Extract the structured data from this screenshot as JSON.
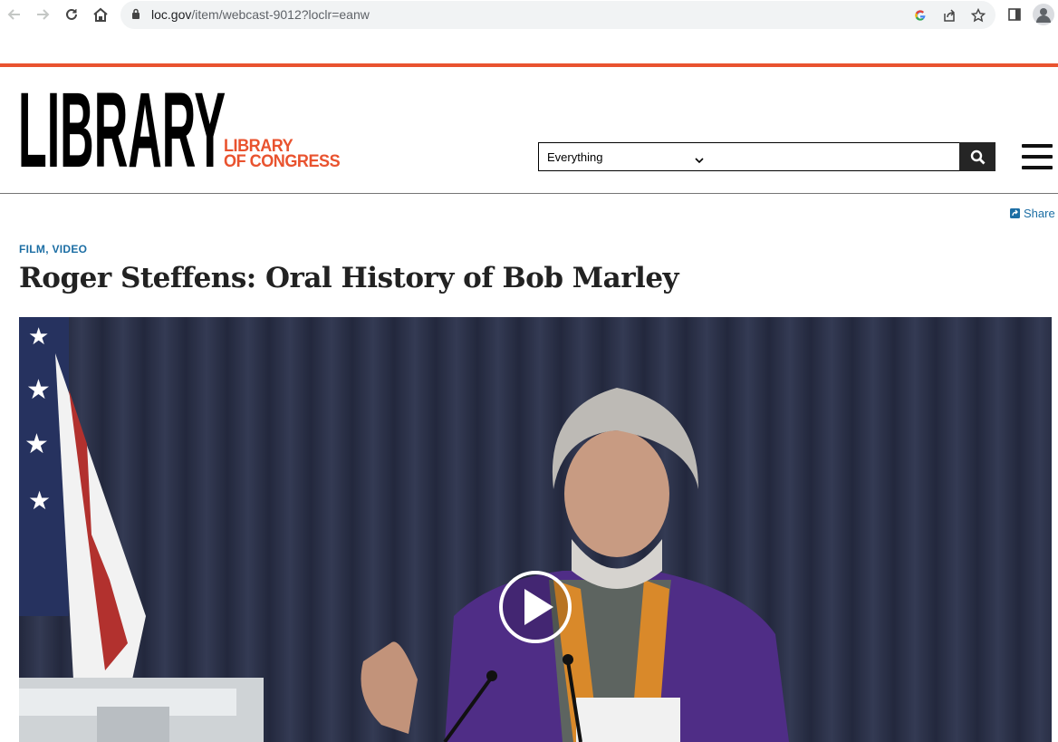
{
  "browser": {
    "url_main": "loc.gov",
    "url_rest": "/item/webcast-9012?loclr=eanw"
  },
  "header": {
    "logo_big": "LIBRARY",
    "logo_line1": "LIBRARY",
    "logo_line2": "OF CONGRESS",
    "search_scope": "Everything",
    "search_value": ""
  },
  "item": {
    "share_label": "Share",
    "format": "FILM, VIDEO",
    "title": "Roger Steffens: Oral History of Bob Marley"
  },
  "colors": {
    "accent": "#e9532f",
    "link": "#1c6ea4"
  }
}
